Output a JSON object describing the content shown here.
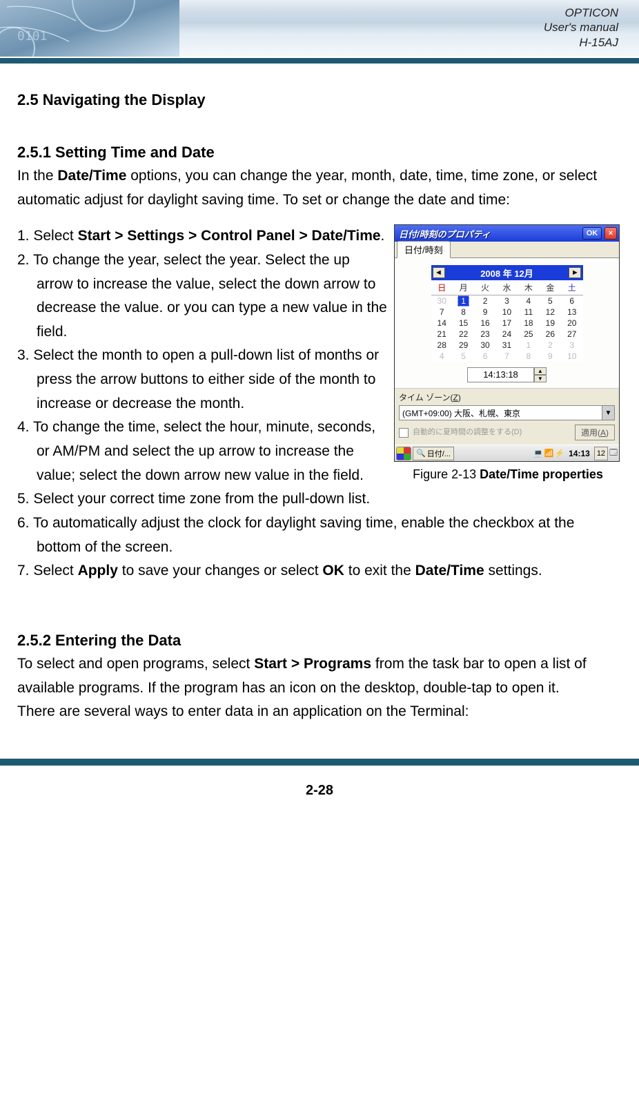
{
  "header": {
    "line1": "OPTICON",
    "line2": "User's manual",
    "line3": "H-15AJ"
  },
  "section1": {
    "heading": "2.5 Navigating the Display",
    "sub1": {
      "heading": "2.5.1 Setting Time and Date",
      "intro_pre": "In the ",
      "intro_bold": "Date/Time",
      "intro_post": " options, you can change the year, month, date, time, time zone, or select automatic adjust for daylight saving time. To set or change the date and time:",
      "steps": {
        "s1_pre": "1.  Select ",
        "s1_bold": "Start > Settings > Control Panel > Date/Time",
        "s1_post": ".",
        "s2": "2.  To change the year, select the year. Select the up arrow to increase the value, select the down arrow to decrease the value. or you can type a new value in the field.",
        "s3": "3.  Select the month to open a pull-down list of months or press the arrow buttons to either side of the month to increase or decrease the month.",
        "s4": "4.  To change the time, select the hour, minute, seconds, or AM/PM and select the up arrow to increase the value; select the down arrow new value in the field.",
        "s5": "5. Select your correct time zone from the pull-down list.",
        "s6": "6. To automatically adjust the clock for daylight saving time, enable the checkbox at the bottom of the screen.",
        "s7_pre": "7. Select ",
        "s7_b1": "Apply",
        "s7_mid": " to save your changes or select ",
        "s7_b2": "OK",
        "s7_mid2": " to exit the ",
        "s7_b3": "Date/Time",
        "s7_post": " settings."
      },
      "figure": {
        "window_title": "日付/時刻のプロパティ",
        "ok": "OK",
        "close": "×",
        "tab": "日付/時刻",
        "month_label": "2008 年 12月",
        "dow": {
          "sun": "日",
          "mon": "月",
          "tue": "火",
          "wed": "水",
          "thu": "木",
          "fri": "金",
          "sat": "土"
        },
        "rows": [
          [
            "30",
            "1",
            "2",
            "3",
            "4",
            "5",
            "6"
          ],
          [
            "7",
            "8",
            "9",
            "10",
            "11",
            "12",
            "13"
          ],
          [
            "14",
            "15",
            "16",
            "17",
            "18",
            "19",
            "20"
          ],
          [
            "21",
            "22",
            "23",
            "24",
            "25",
            "26",
            "27"
          ],
          [
            "28",
            "29",
            "30",
            "31",
            "1",
            "2",
            "3"
          ],
          [
            "4",
            "5",
            "6",
            "7",
            "8",
            "9",
            "10"
          ]
        ],
        "time_value": "14:13:18",
        "tz_label_pre": "タイム ゾーン(",
        "tz_label_ul": "Z",
        "tz_label_post": ")",
        "tz_value": "(GMT+09:00) 大阪、札幌、東京",
        "dst_text": "自動的に夏時間の調整をする(D)",
        "apply_pre": "適用(",
        "apply_ul": "A",
        "apply_post": ")",
        "taskbar_app": "日付/...",
        "taskbar_time": "14:13",
        "taskbar_num": "12",
        "caption_pre": "Figure 2-13 ",
        "caption_bold": "Date/Time properties"
      }
    },
    "sub2": {
      "heading": "2.5.2 Entering the Data",
      "p1_pre": "To select and open programs, select ",
      "p1_bold": "Start > Programs",
      "p1_post": " from the task bar to open a list of available programs. If the program has an icon on the desktop, double-tap to open it.",
      "p2": "There are several ways to enter data in an application on the Terminal:"
    }
  },
  "page_number": "2-28"
}
